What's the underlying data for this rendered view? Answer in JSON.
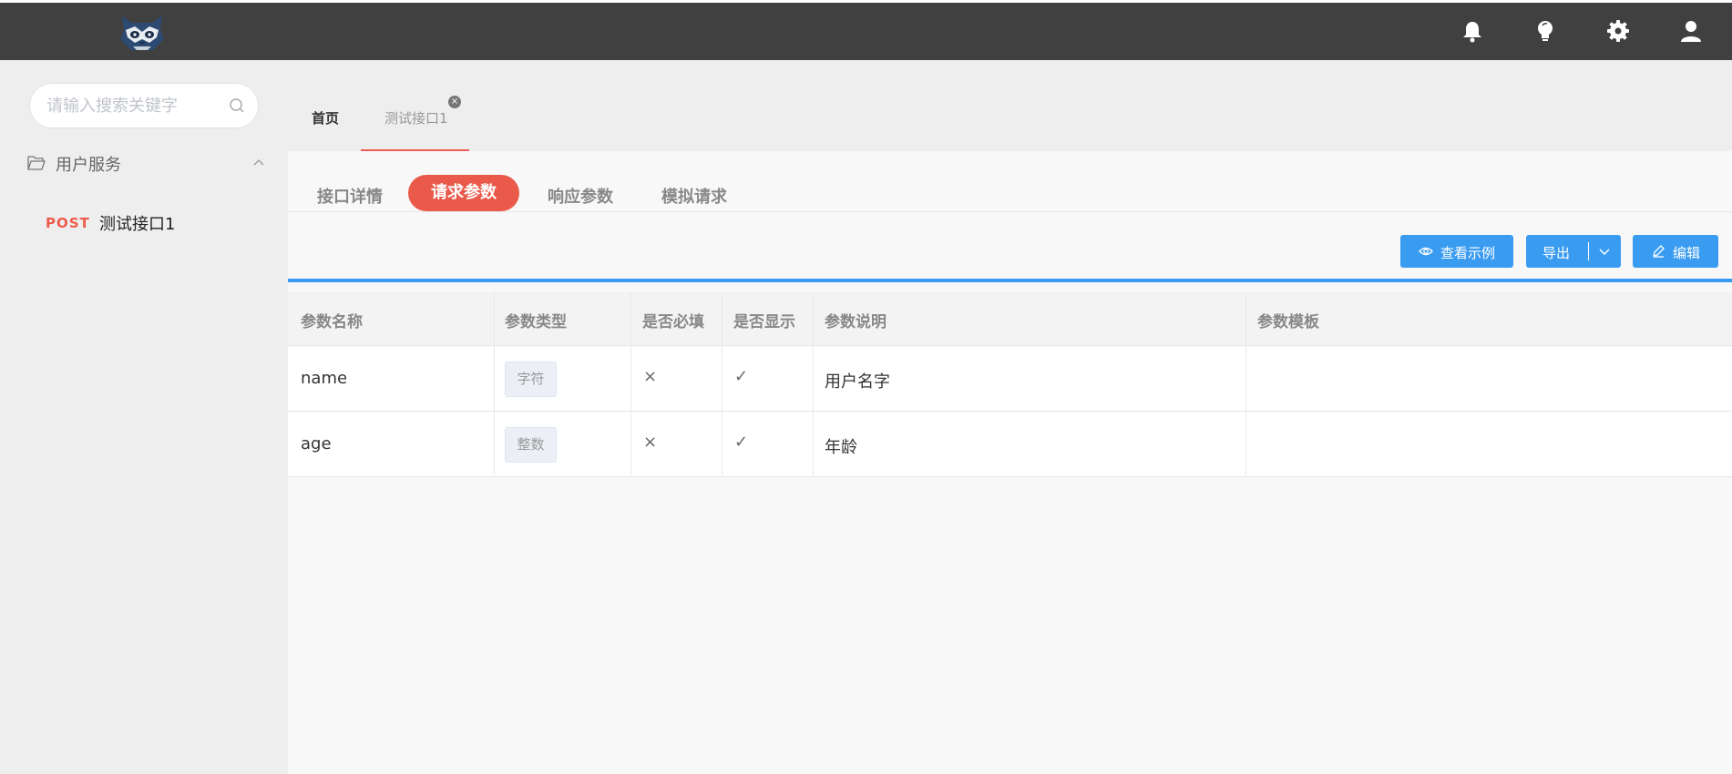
{
  "header": {
    "icons": [
      "bell-icon",
      "bulb-icon",
      "gear-icon",
      "user-icon"
    ]
  },
  "sidebar": {
    "search_placeholder": "请输入搜索关键字",
    "folder_label": "用户服务",
    "items": [
      {
        "method": "POST",
        "name": "测试接口1"
      }
    ]
  },
  "page_tabs": {
    "home": "首页",
    "current": "测试接口1",
    "close_glyph": "×"
  },
  "subtabs": [
    "接口详情",
    "请求参数",
    "响应参数",
    "模拟请求"
  ],
  "active_subtab": "请求参数",
  "toolbar": {
    "view_example": "查看示例",
    "export": "导出",
    "edit": "编辑"
  },
  "table": {
    "headers": [
      "参数名称",
      "参数类型",
      "是否必填",
      "是否显示",
      "参数说明",
      "参数模板"
    ],
    "rows": [
      {
        "name": "name",
        "type": "字符",
        "required": "×",
        "visible": "✓",
        "description": "用户名字",
        "template": ""
      },
      {
        "name": "age",
        "type": "整数",
        "required": "×",
        "visible": "✓",
        "description": "年龄",
        "template": ""
      }
    ]
  },
  "colors": {
    "accent": "#e95a4a",
    "primary": "#3a9cf0",
    "header_bg": "#404040"
  }
}
